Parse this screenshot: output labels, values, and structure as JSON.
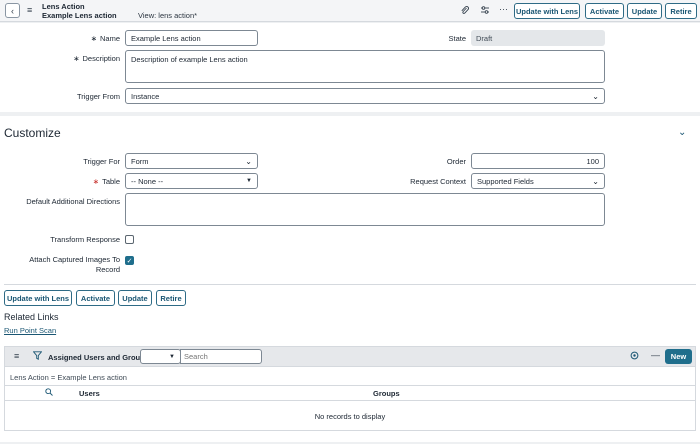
{
  "header": {
    "title": "Lens Action",
    "subtitle": "Example Lens action",
    "view": "View: lens action*",
    "buttons": {
      "update_with_lens": "Update with Lens",
      "activate": "Activate",
      "update": "Update",
      "retire": "Retire"
    }
  },
  "form": {
    "name_label": "Name",
    "name_value": "Example Lens action",
    "state_label": "State",
    "state_value": "Draft",
    "description_label": "Description",
    "description_value": "Description of example Lens action",
    "trigger_from_label": "Trigger From",
    "trigger_from_value": "Instance"
  },
  "customize": {
    "title": "Customize",
    "trigger_for_label": "Trigger For",
    "trigger_for_value": "Form",
    "order_label": "Order",
    "order_value": "100",
    "table_label": "Table",
    "table_value": "-- None --",
    "request_context_label": "Request Context",
    "request_context_value": "Supported Fields",
    "default_directions_label": "Default Additional Directions",
    "default_directions_value": "",
    "transform_response_label": "Transform Response",
    "transform_response_checked": false,
    "attach_images_label_1": "Attach Captured Images To",
    "attach_images_label_2": "Record",
    "attach_images_checked": true
  },
  "bottom_buttons": {
    "update_with_lens": "Update with Lens",
    "activate": "Activate",
    "update": "Update",
    "retire": "Retire"
  },
  "related_links": {
    "title": "Related Links",
    "items": [
      "Run Point Scan"
    ]
  },
  "related_list": {
    "title": "Assigned Users and Groups",
    "search_placeholder": "Search",
    "new_label": "New",
    "breadcrumb": "Lens Action = Example Lens action",
    "columns": [
      "Users",
      "Groups"
    ],
    "empty_message": "No records to display"
  },
  "colors": {
    "accent": "#1a5673",
    "new_button": "#1f6e8c",
    "required": "#c8332f"
  }
}
